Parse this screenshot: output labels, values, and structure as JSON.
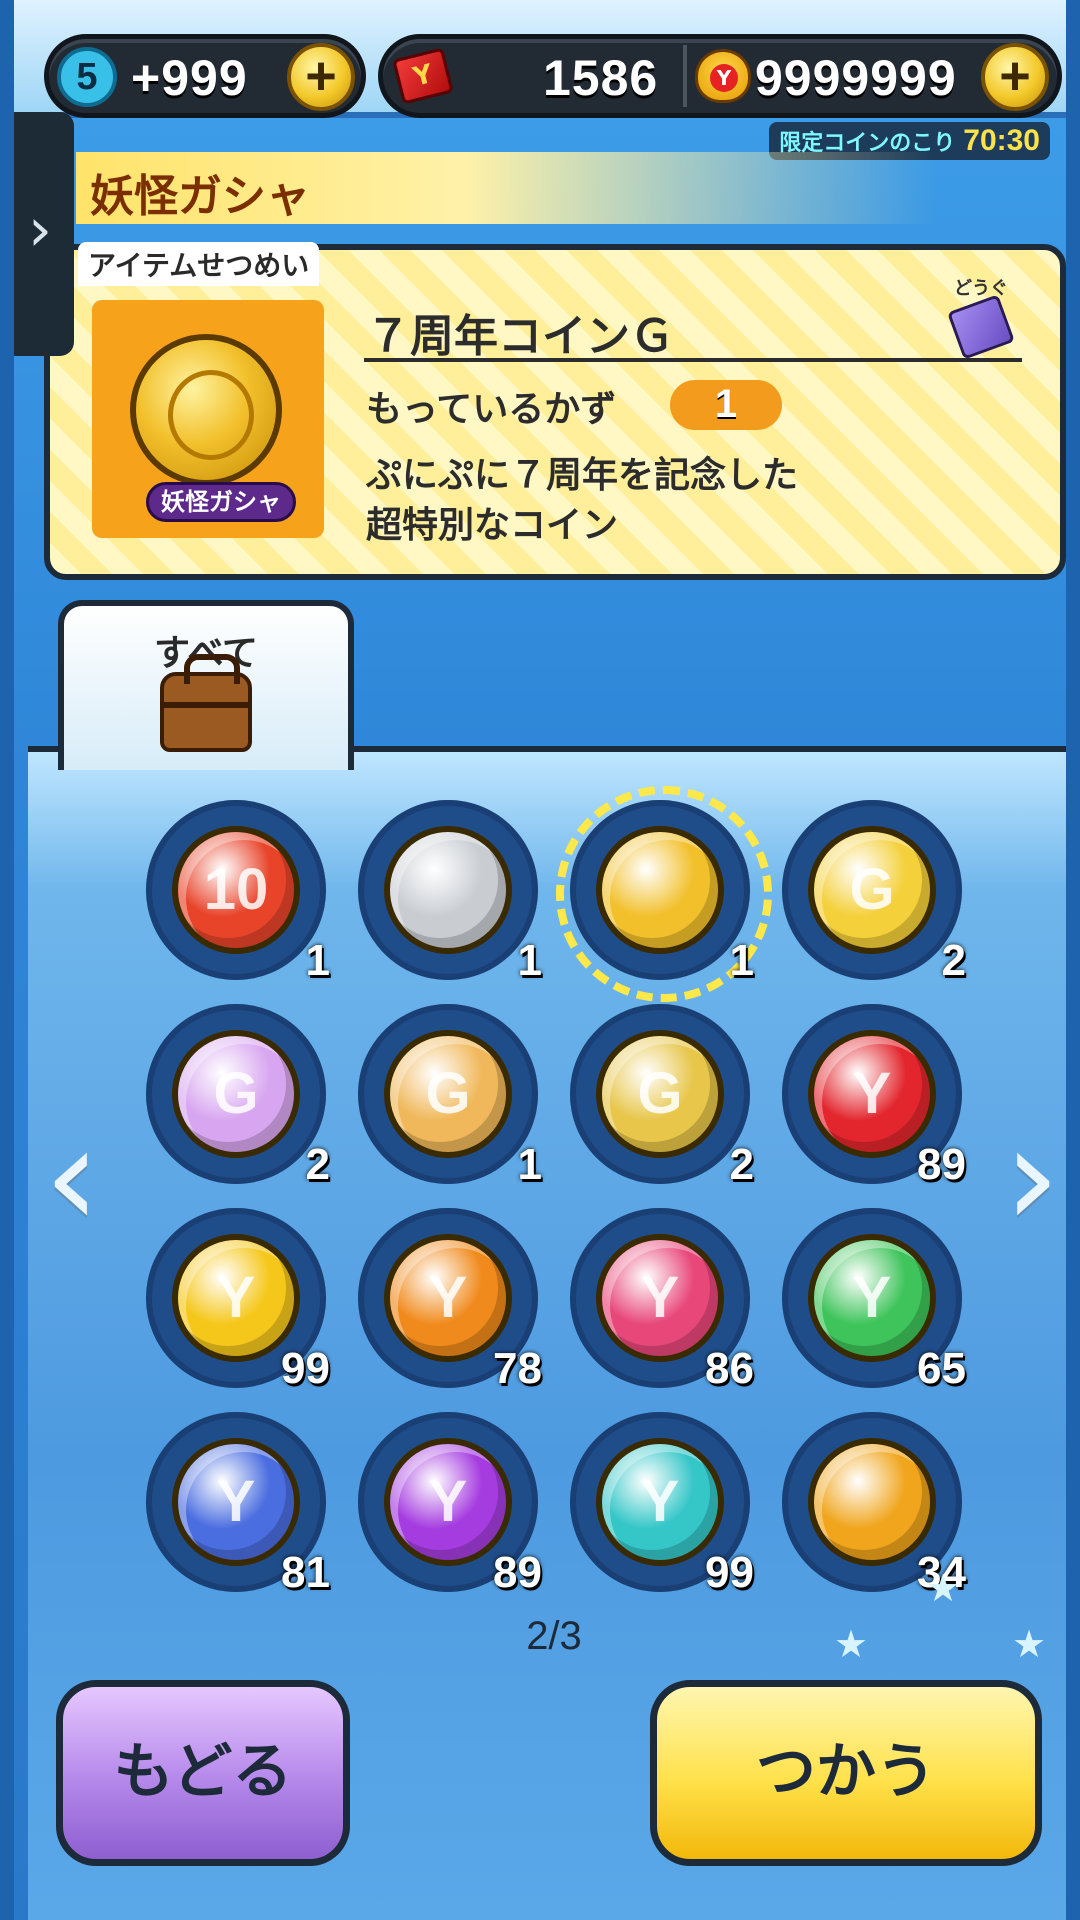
{
  "topbar": {
    "stamina_level": "5",
    "stamina_value": "+999",
    "ticket_value": "1586",
    "money_value": "9999999",
    "limited_label": "限定コインのこり",
    "limited_time": "70:30"
  },
  "header": {
    "title": "妖怪ガシャ"
  },
  "item": {
    "section_label": "アイテムせつめい",
    "name": "７周年コインＧ",
    "category_label": "どうぐ",
    "badge": "妖怪ガシャ",
    "own_label": "もっているかず",
    "own_count": "1",
    "desc_line1": "ぷにぷに７周年を記念した",
    "desc_line2": "超特別なコイン"
  },
  "tab": {
    "label": "すべて"
  },
  "coins": [
    {
      "icon": "10-coin-icon",
      "symbol": "10",
      "color": "#e8442a",
      "count": "1"
    },
    {
      "icon": "silver-coin-icon",
      "symbol": "",
      "color": "#c9cdd2",
      "count": "1"
    },
    {
      "icon": "gold-coin-icon",
      "symbol": "",
      "color": "#f2c02b",
      "count": "1",
      "selected": true
    },
    {
      "icon": "star-g-coin-icon",
      "symbol": "G",
      "color": "#f4d03a",
      "count": "2"
    },
    {
      "icon": "star-g-coin-purple-icon",
      "symbol": "G",
      "color": "#d8a6f0",
      "count": "2"
    },
    {
      "icon": "star-g-coin-multi-icon",
      "symbol": "G",
      "color": "#f0b85a",
      "count": "1"
    },
    {
      "icon": "star-g-coin-navy-icon",
      "symbol": "G",
      "color": "#e7c64a",
      "count": "2"
    },
    {
      "icon": "red-y-coin-icon",
      "symbol": "Y",
      "color": "#e3262e",
      "count": "89"
    },
    {
      "icon": "yellow-y-coin-icon",
      "symbol": "Y",
      "color": "#f5c71a",
      "count": "99"
    },
    {
      "icon": "orange-y-coin-icon",
      "symbol": "Y",
      "color": "#f08a1c",
      "count": "78"
    },
    {
      "icon": "pink-y-coin-icon",
      "symbol": "Y",
      "color": "#e8477a",
      "count": "86"
    },
    {
      "icon": "green-y-coin-icon",
      "symbol": "Y",
      "color": "#3ec45a",
      "count": "65"
    },
    {
      "icon": "blue-y-coin-icon",
      "symbol": "Y",
      "color": "#4a6de0",
      "count": "81"
    },
    {
      "icon": "purple-y-coin-icon",
      "symbol": "Y",
      "color": "#a53ce0",
      "count": "89"
    },
    {
      "icon": "cyan-y-coin-icon",
      "symbol": "Y",
      "color": "#35c6c8",
      "count": "99"
    },
    {
      "icon": "fire-coin-icon",
      "symbol": "",
      "color": "#f0a51c",
      "count": "34"
    }
  ],
  "pagination": {
    "indicator": "2/3"
  },
  "buttons": {
    "back": "もどる",
    "use": "つかう"
  }
}
